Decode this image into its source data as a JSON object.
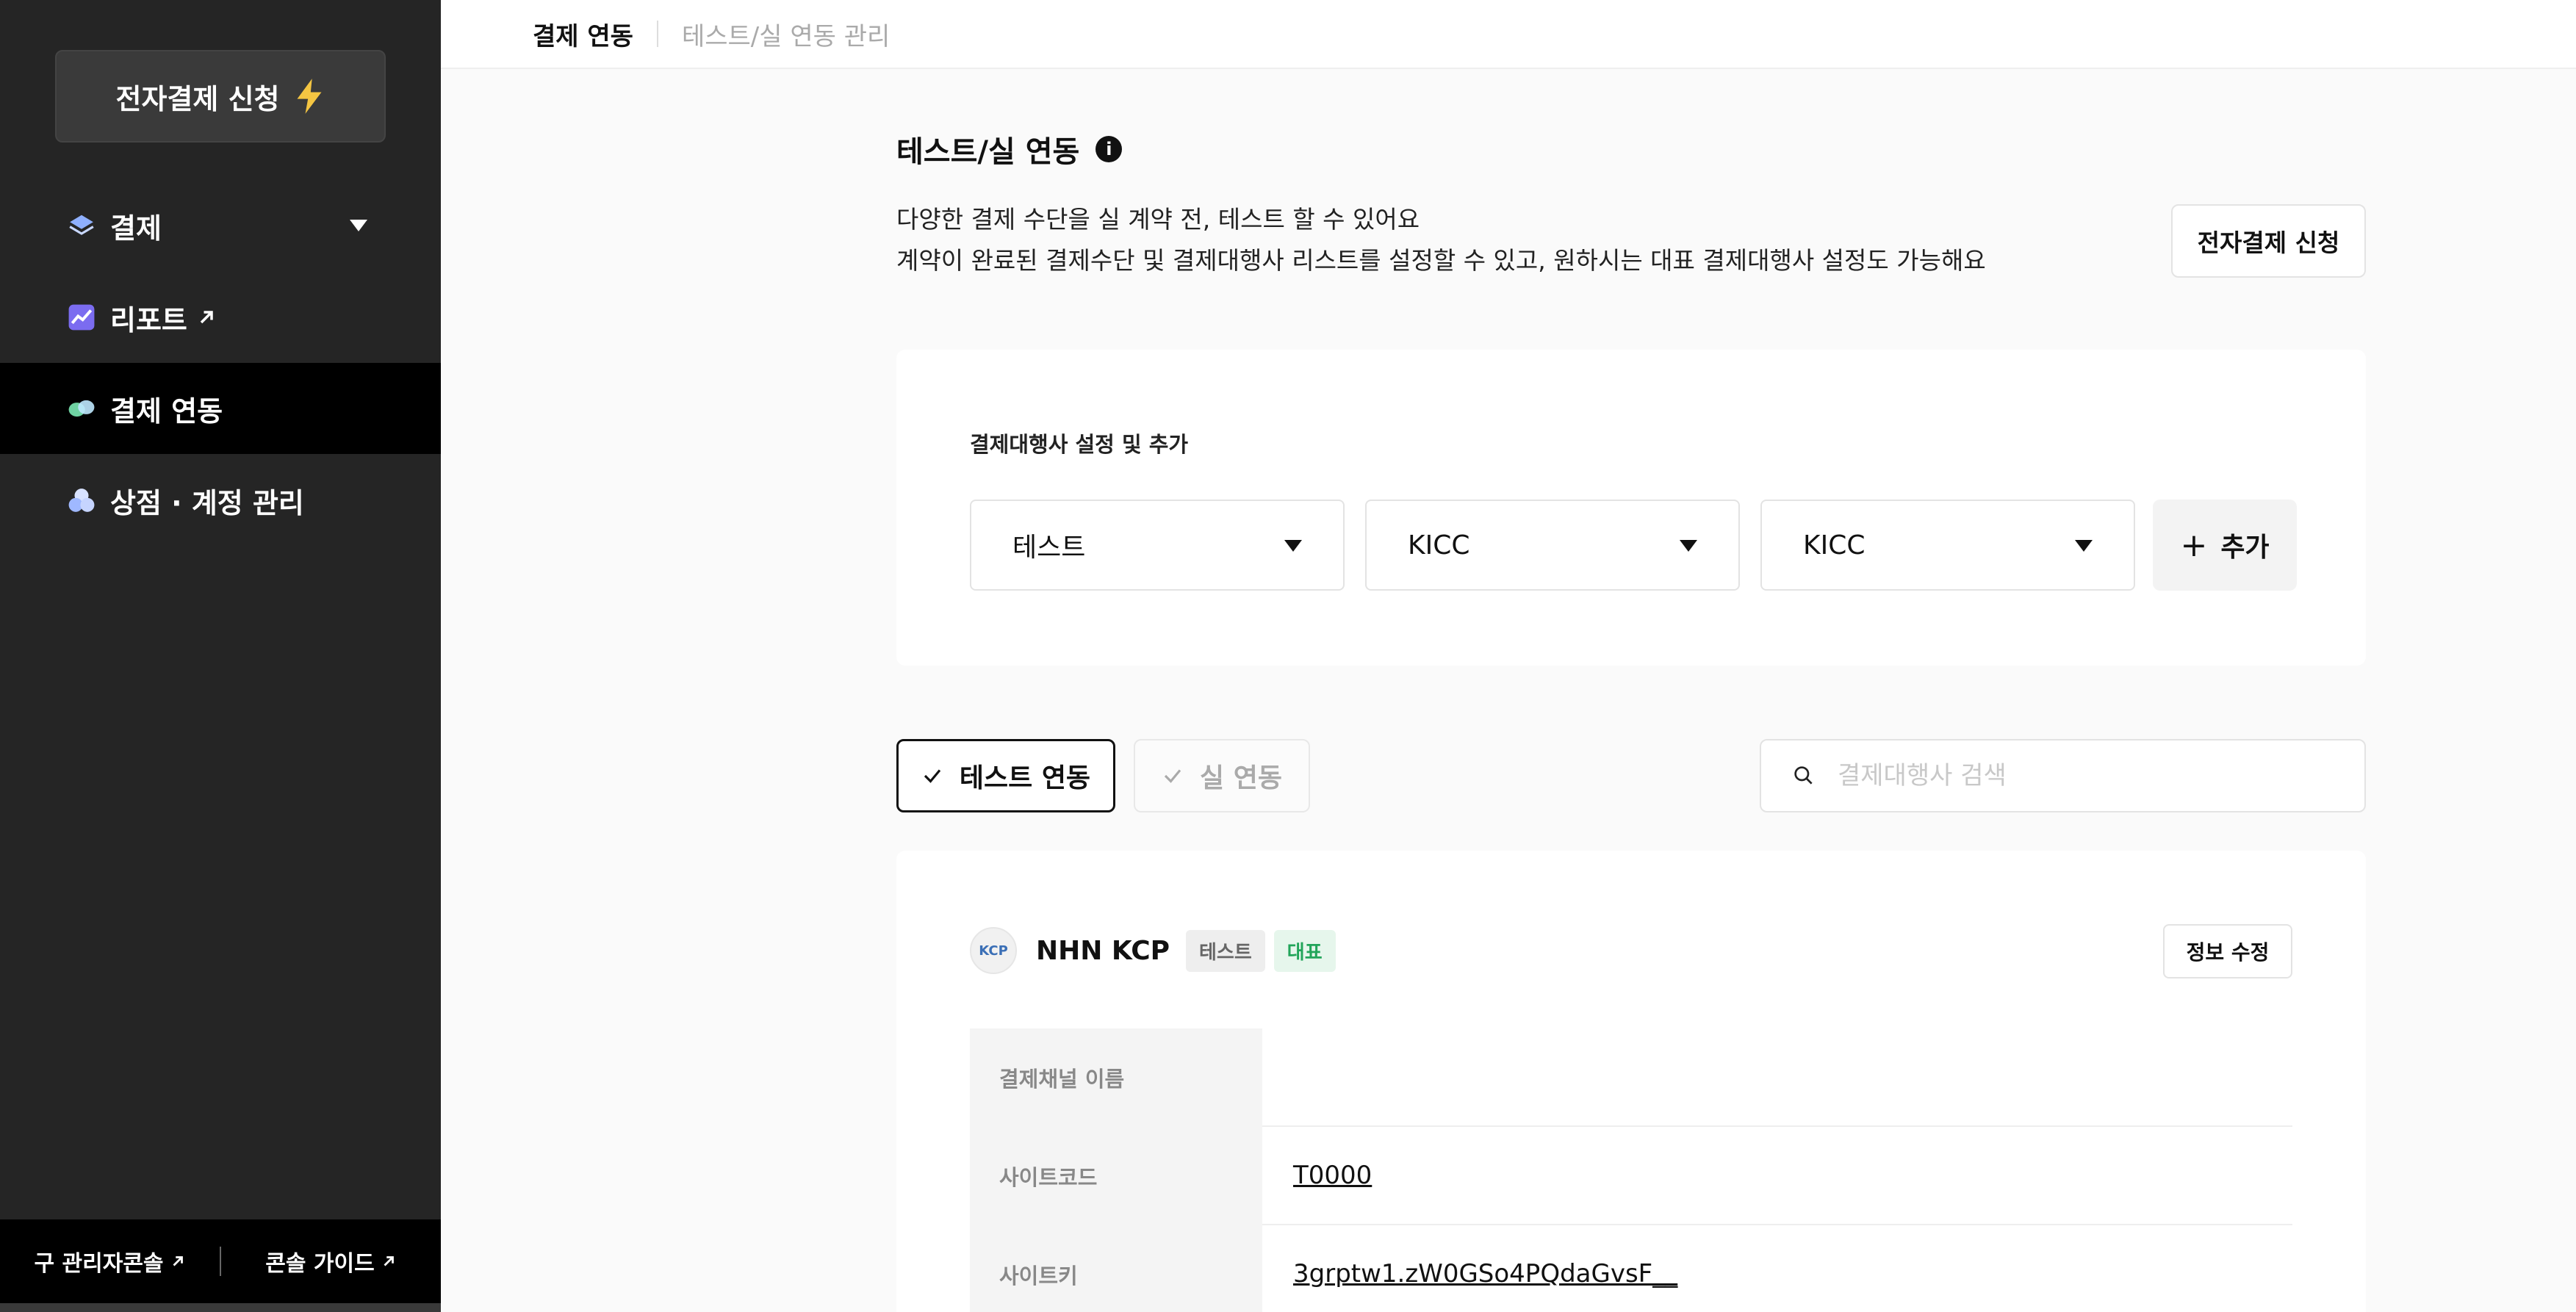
{
  "sidebar": {
    "apply_label": "전자결제 신청",
    "items": [
      {
        "label": "결제",
        "icon": "layers-icon"
      },
      {
        "label": "리포트",
        "icon": "chart-icon"
      },
      {
        "label": "결제 연동",
        "icon": "link-icon"
      },
      {
        "label": "상점 · 계정 관리",
        "icon": "users-icon"
      }
    ],
    "footer": {
      "old_console": "구 관리자콘솔",
      "guide": "콘솔 가이드"
    }
  },
  "topbar": {
    "active_tab": "결제 연동",
    "inactive_tab": "테스트/실 연동 관리"
  },
  "header": {
    "title": "테스트/실 연동",
    "desc_line1": "다양한 결제 수단을 실 계약 전, 테스트 할 수 있어요",
    "desc_line2": "계약이 완료된 결제수단 및 결제대행사 리스트를 설정할 수 있고, 원하시는 대표 결제대행사 설정도 가능해요",
    "apply_button": "전자결제 신청"
  },
  "pg_settings": {
    "label": "결제대행사 설정 및 추가",
    "selects": [
      "테스트",
      "KICC",
      "KICC"
    ],
    "add_button": "추가"
  },
  "filters": {
    "test_label": "테스트 연동",
    "live_label": "실 연동",
    "search_placeholder": "결제대행사 검색"
  },
  "pg_card": {
    "logo_text": "KCP",
    "name": "NHN KCP",
    "badge_test": "테스트",
    "badge_primary": "대표",
    "edit_button": "정보 수정",
    "rows": [
      {
        "key": "결제채널 이름",
        "value": ""
      },
      {
        "key": "사이트코드",
        "value": "T0000"
      },
      {
        "key": "사이트키",
        "value": "3grptw1.zW0GSo4PQdaGvsF__"
      }
    ]
  },
  "colors": {
    "sidebar_bg": "#252525",
    "active_bg": "#000000",
    "badge_green": "#22a55a"
  }
}
